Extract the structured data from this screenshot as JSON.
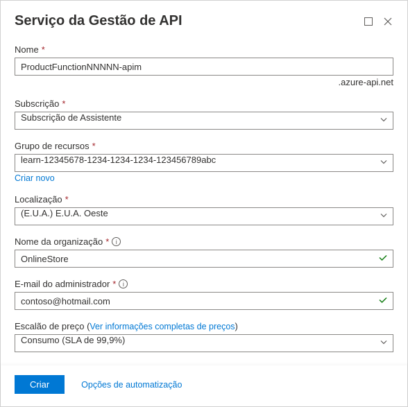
{
  "header": {
    "title": "Serviço da Gestão de API"
  },
  "fields": {
    "name": {
      "label": "Nome",
      "value": "ProductFunctionNNNNN-apim",
      "suffix": ".azure-api.net"
    },
    "subscription": {
      "label": "Subscrição",
      "value": "Subscrição de Assistente"
    },
    "resourceGroup": {
      "label": "Grupo de recursos",
      "value": "learn-12345678-1234-1234-1234-123456789abc",
      "createNewLink": "Criar novo"
    },
    "location": {
      "label": "Localização",
      "value": "(E.U.A.) E.U.A. Oeste"
    },
    "orgName": {
      "label": "Nome da organização",
      "value": "OnlineStore"
    },
    "adminEmail": {
      "label": "E-mail do administrador",
      "value": "contoso@hotmail.com"
    },
    "pricingTier": {
      "label": "Escalão de preço (",
      "link": "Ver informações completas de preços",
      "labelClose": ")",
      "value": "Consumo (SLA de 99,9%)"
    }
  },
  "footer": {
    "createButton": "Criar",
    "automationLink": "Opções de automatização"
  }
}
